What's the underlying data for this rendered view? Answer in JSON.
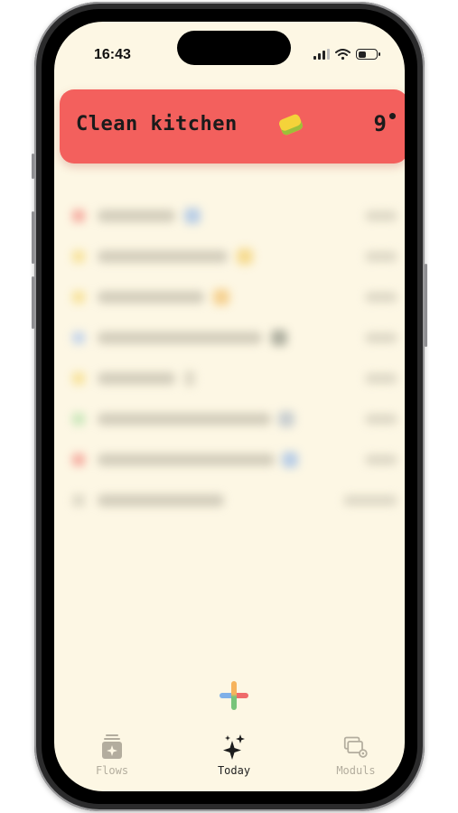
{
  "status_bar": {
    "time": "16:43"
  },
  "current_task": {
    "title": "Clean kitchen",
    "emoji_icon": "sponge-icon",
    "count": "9"
  },
  "tabs": [
    {
      "label": "Flows",
      "icon": "flows-icon",
      "active": false
    },
    {
      "label": "Today",
      "icon": "sparkle-icon",
      "active": true
    },
    {
      "label": "Moduls",
      "icon": "modules-icon",
      "active": false
    }
  ],
  "colors": {
    "background": "#fdf7e4",
    "task_card": "#f3605d",
    "active_tab": "#222222",
    "inactive_tab": "#b3ad9e"
  }
}
